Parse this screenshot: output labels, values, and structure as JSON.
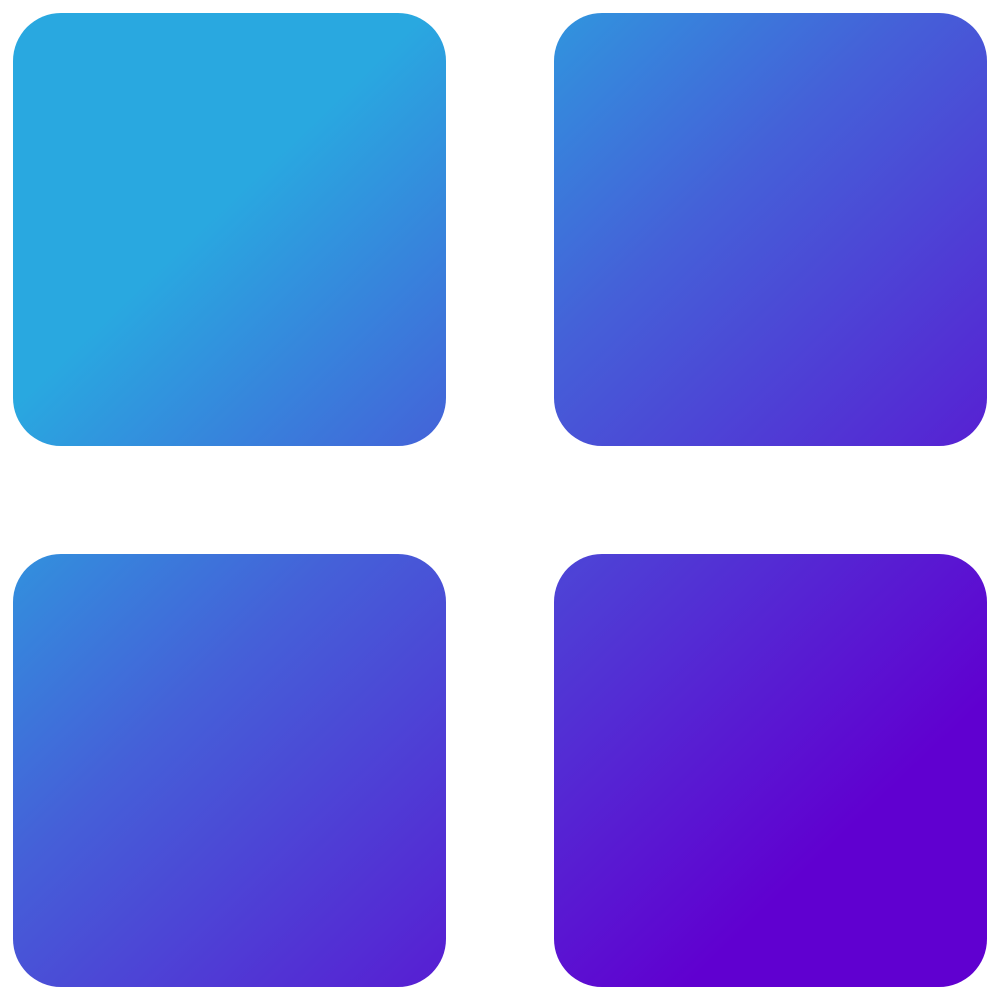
{
  "icon": {
    "name": "apps-grid-icon",
    "tile_count": 4,
    "gradient": {
      "start_color": "#29A8E0",
      "end_color": "#6000D0"
    }
  }
}
